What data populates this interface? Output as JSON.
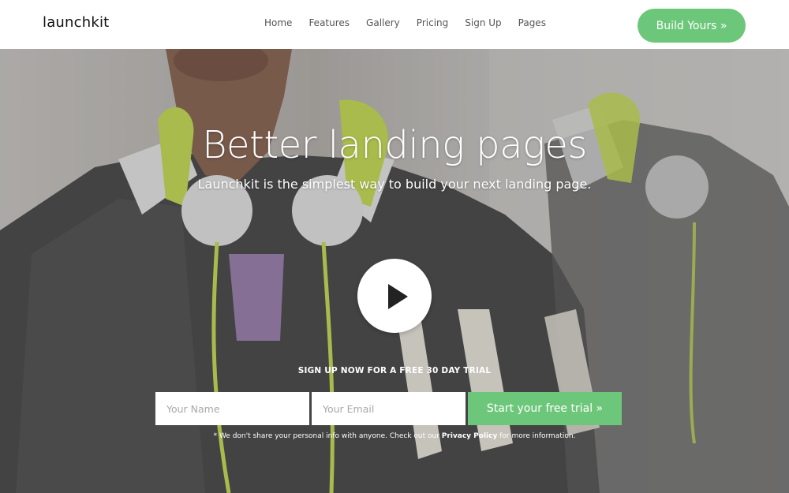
{
  "header": {
    "logo": "launchkit",
    "nav": [
      "Home",
      "Features",
      "Gallery",
      "Pricing",
      "Sign Up",
      "Pages"
    ],
    "cta_label": "Build Yours »"
  },
  "hero": {
    "title": "Better landing pages",
    "subtitle": "Launchkit is the simplest way to build your next landing page.",
    "play_icon": "play-icon",
    "signup_label": "SIGN UP NOW FOR A FREE 30 DAY TRIAL",
    "name_placeholder": "Your Name",
    "email_placeholder": "Your Email",
    "submit_label": "Start your free trial »",
    "privacy_prefix": "* We don't share your personal info with anyone. Check out our",
    "privacy_link": "Privacy Policy",
    "privacy_suffix": "for more information."
  },
  "colors": {
    "accent": "#6dc77a",
    "header_bg": "#ffffff",
    "text_dark": "#111111"
  }
}
